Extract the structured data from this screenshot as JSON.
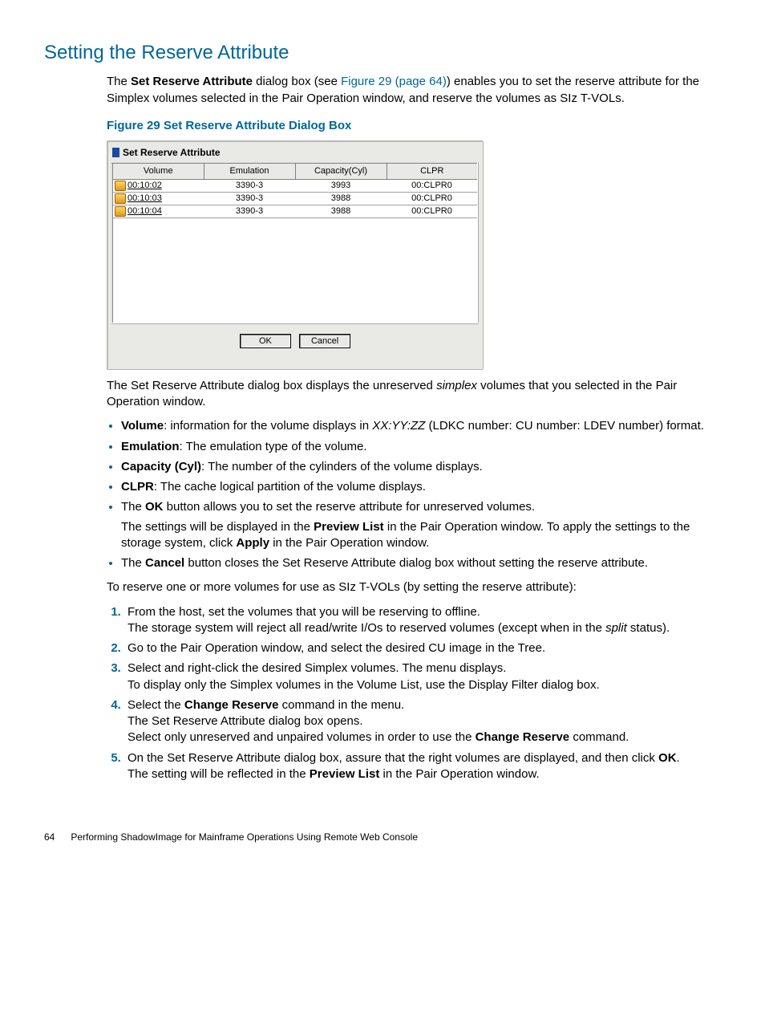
{
  "section_title": "Setting the Reserve Attribute",
  "intro": {
    "pre": "The ",
    "b1": "Set Reserve Attribute",
    "mid": " dialog box (see ",
    "link": "Figure 29 (page 64)",
    "post": ") enables you to set the reserve attribute for the Simplex volumes selected in the Pair Operation window, and reserve the volumes as SIz T-VOLs."
  },
  "figure_caption": "Figure 29 Set Reserve Attribute Dialog Box",
  "dialog": {
    "title": "Set Reserve Attribute",
    "headers": {
      "c0": "Volume",
      "c1": "Emulation",
      "c2": "Capacity(Cyl)",
      "c3": "CLPR"
    },
    "rows": [
      {
        "volume": "00:10:02",
        "emu": "3390-3",
        "cap": "3993",
        "clpr": "00:CLPR0"
      },
      {
        "volume": "00:10:03",
        "emu": "3390-3",
        "cap": "3988",
        "clpr": "00:CLPR0"
      },
      {
        "volume": "00:10:04",
        "emu": "3390-3",
        "cap": "3988",
        "clpr": "00:CLPR0"
      }
    ],
    "ok": "OK",
    "cancel": "Cancel"
  },
  "para_after_fig_a": "The Set Reserve Attribute dialog box displays the unreserved ",
  "para_after_fig_em": "simplex",
  "para_after_fig_b": " volumes that you selected in the Pair Operation window.",
  "bullets": {
    "b0a": "Volume",
    "b0b": ": information for the volume displays in ",
    "b0em": "XX:YY:ZZ",
    "b0c": " (LDKC number: CU number: LDEV number) format.",
    "b1a": "Emulation",
    "b1b": ": The emulation type of the volume.",
    "b2a": "Capacity (Cyl)",
    "b2b": ": The number of the cylinders of the volume displays.",
    "b3a": "CLPR",
    "b3b": ": The cache logical partition of the volume displays.",
    "b4a": "The ",
    "b4b": "OK",
    "b4c": " button allows you to set the reserve attribute for unreserved volumes.",
    "b4sub_a": "The settings will be displayed in the ",
    "b4sub_b": "Preview List",
    "b4sub_c": " in the Pair Operation window. To apply the settings to the storage system, click ",
    "b4sub_d": "Apply",
    "b4sub_e": " in the Pair Operation window.",
    "b5a": "The ",
    "b5b": "Cancel",
    "b5c": " button closes the Set Reserve Attribute dialog box without setting the reserve attribute."
  },
  "para_reserve": "To reserve one or more volumes for use as SIz T-VOLs (by setting the reserve attribute):",
  "steps": {
    "s1a": "From the host, set the volumes that you will be reserving to offline.",
    "s1b_a": "The storage system will reject all read/write I/Os to reserved volumes (except when in the ",
    "s1b_em": "split",
    "s1b_b": " status).",
    "s2": "Go to the Pair Operation window, and select the desired CU image in the Tree.",
    "s3a": "Select and right-click the desired Simplex volumes. The menu displays.",
    "s3b": "To display only the Simplex volumes in the Volume List, use the Display Filter dialog box.",
    "s4a_a": "Select the ",
    "s4a_b": "Change Reserve",
    "s4a_c": " command in the menu.",
    "s4b": "The Set Reserve Attribute dialog box opens.",
    "s4c_a": "Select only unreserved and unpaired volumes in order to use the ",
    "s4c_b": "Change Reserve",
    "s4c_c": " command.",
    "s5a_a": "On the Set Reserve Attribute dialog box, assure that the right volumes are displayed, and then click ",
    "s5a_b": "OK",
    "s5a_c": ".",
    "s5b_a": "The setting will be reflected in the ",
    "s5b_b": "Preview List",
    "s5b_c": " in the Pair Operation window."
  },
  "footer": {
    "page": "64",
    "chapter": "Performing ShadowImage for Mainframe Operations Using Remote Web Console"
  }
}
